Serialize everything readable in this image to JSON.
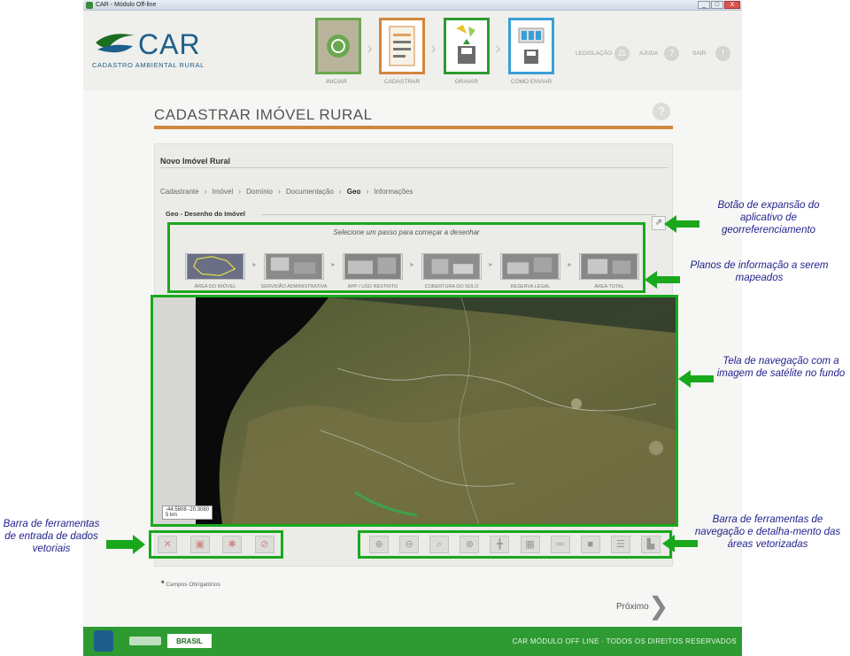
{
  "window": {
    "title": "CAR - Módulo Off-line",
    "buttons": [
      "_",
      "□",
      "X"
    ]
  },
  "header": {
    "logo_text": "CAR",
    "logo_sub": "CADASTRO AMBIENTAL RURAL",
    "steps": [
      {
        "label": "INICIAR",
        "color": "#6aa84f"
      },
      {
        "label": "CADASTRAR",
        "color": "#d1873d"
      },
      {
        "label": "GRAVAR",
        "color": "#2e9a32"
      },
      {
        "label": "COMO ENVIAR",
        "color": "#3a9fd6"
      }
    ],
    "links": [
      {
        "label": "LEGISLAÇÃO",
        "icon": "scales-icon"
      },
      {
        "label": "AJUDA",
        "icon": "help-icon"
      },
      {
        "label": "SAIR",
        "icon": "exit-icon"
      }
    ]
  },
  "page": {
    "title": "CADASTRAR IMÓVEL RURAL",
    "help": "?",
    "panel_title": "Novo Imóvel Rural",
    "breadcrumbs": [
      "Cadastrante",
      "Imóvel",
      "Domínio",
      "Documentação",
      "Geo",
      "Informações"
    ],
    "active_step": "Geo",
    "geo_title": "Geo - Desenho do Imóvel",
    "layers_prompt": "Selecione um passo para começar a desenhar",
    "layers": [
      "ÁREA DO IMÓVEL",
      "SERVIDÃO ADMINISTRATIVA",
      "APP / USO RESTRITO",
      "COBERTURA DO SOLO",
      "RESERVA LEGAL",
      "ÁREA TOTAL"
    ],
    "coordinates": "-44.5808 -20.3080",
    "scale": "5 km",
    "required_note": "Campos Obrigatórios",
    "required_mark": "*",
    "next_label": "Próximo"
  },
  "toolbars": {
    "left": [
      "draw-polygon-icon",
      "draw-rect-icon",
      "draw-point-icon",
      "delete-icon"
    ],
    "right": [
      "zoom-in-icon",
      "zoom-out-icon",
      "zoom-icon",
      "zoom-extent-icon",
      "measure-icon",
      "pan-icon",
      "ruler-icon",
      "layer-icon",
      "grid-icon",
      "legend-icon"
    ]
  },
  "footer": {
    "text": "CAR  MÓDULO OFF LINE  ·  TODOS OS DIREITOS RESERVADOS",
    "brasil": "BRASIL"
  },
  "annotations": {
    "expand": "Botão de expansão do aplicativo de georreferenciamento",
    "layers": "Planos de informação a serem mapeados",
    "map": "Tela de navegação com a imagem de satélite no fundo",
    "left_toolbar": "Barra de ferramentas de entrada de dados vetoriais",
    "right_toolbar": "Barra de ferramentas de navegação e detalha-mento das áreas vetorizadas"
  },
  "colors": {
    "highlight": "#19a81c",
    "annotation": "#1f1f8c",
    "accent": "#d1873d"
  }
}
